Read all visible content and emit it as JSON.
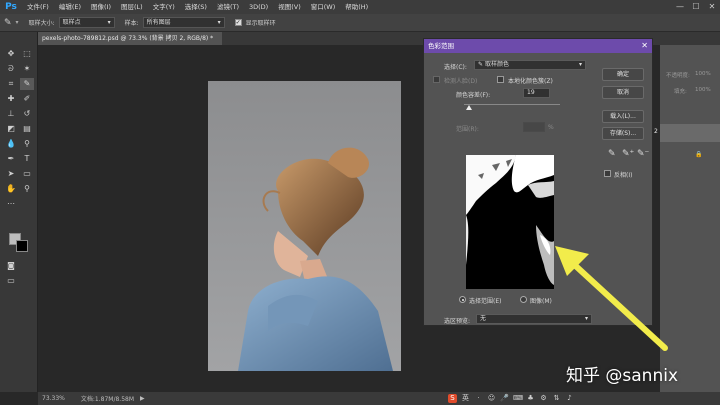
{
  "app": {
    "logo": "Ps"
  },
  "menu": [
    "文件(F)",
    "编辑(E)",
    "图像(I)",
    "图层(L)",
    "文字(Y)",
    "选择(S)",
    "滤镜(T)",
    "3D(D)",
    "视图(V)",
    "窗口(W)",
    "帮助(H)"
  ],
  "window_controls": [
    "—",
    "☐",
    "✕"
  ],
  "options": {
    "sample_size_label": "取样大小:",
    "sample_size_value": "取样点",
    "sample_label": "样本:",
    "sample_value": "所有图层",
    "show_ring_label": "显示取样环"
  },
  "document": {
    "tab_title": "pexels-photo-789812.psd @ 73.3% (背景 拷贝 2, RGB/8) *",
    "tab_close": "×"
  },
  "status": {
    "zoom": "73.33%",
    "doc_size": "文档:1.87M/8.58M",
    "arrow": "▶"
  },
  "right_panel": {
    "item1": "不透明度:",
    "item1_value": "100%",
    "item2": "填充:",
    "item2_value": "100%",
    "layer_num": "2",
    "layer_opacity": "100%"
  },
  "dialog": {
    "title": "色彩范围",
    "close": "✕",
    "select_label": "选择(C):",
    "select_value": "取样颜色",
    "detect_faces": "检测人脸(D)",
    "localized": "本地化颜色簇(Z)",
    "fuzziness_label": "颜色容差(F):",
    "fuzziness_value": "19",
    "range_label": "范围(R):",
    "range_unit": "%",
    "selection_radio": "选择范围(E)",
    "image_radio": "图像(M)",
    "preview_label": "选区预览:",
    "preview_value": "无",
    "ok": "确定",
    "cancel": "取消",
    "load": "载入(L)...",
    "save": "存储(S)...",
    "invert": "反相(I)"
  },
  "watermark": "知乎 @sannix",
  "taskbar": {
    "ime": "S",
    "lang": "英"
  }
}
